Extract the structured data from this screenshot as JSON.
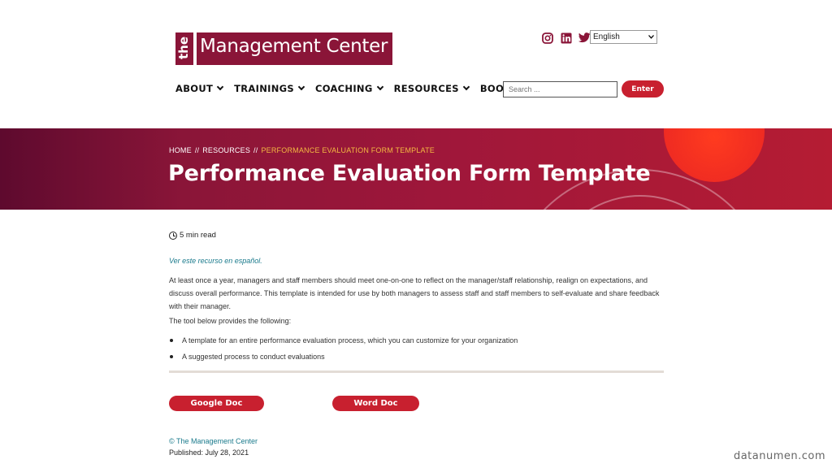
{
  "header": {
    "logo_the": "the",
    "logo_main": "Management Center",
    "social": [
      "instagram-icon",
      "linkedin-icon",
      "twitter-icon"
    ],
    "language": "English",
    "nav": [
      {
        "label": "ABOUT",
        "has_menu": true
      },
      {
        "label": "TRAININGS",
        "has_menu": true
      },
      {
        "label": "COACHING",
        "has_menu": true
      },
      {
        "label": "RESOURCES",
        "has_menu": true
      },
      {
        "label": "BOOK",
        "has_menu": false
      }
    ],
    "search_placeholder": "Search ...",
    "enter_label": "Enter"
  },
  "banner": {
    "breadcrumb": {
      "home": "HOME",
      "sep": "//",
      "resources": "RESOURCES",
      "current": "PERFORMANCE EVALUATION FORM TEMPLATE"
    },
    "title": "Performance Evaluation Form Template"
  },
  "content": {
    "read_time": "5 min read",
    "spanish_link": "Ver este recurso en español.",
    "intro": "At least once a year, managers and staff members should meet one-on-one to reflect on the manager/staff relationship, realign on expectations, and discuss overall performance. This template is intended for use by both managers to assess staff and staff members to self-evaluate and share feedback with their manager.",
    "tool_intro": "The tool below provides the following:",
    "bullets": [
      "A template for an entire performance evaluation process, which you can customize for your organization",
      "A suggested process to conduct evaluations"
    ],
    "google_doc": "Google Doc",
    "word_doc": "Word Doc",
    "copyright": "© The Management Center",
    "published": "Published: July 28, 2021"
  },
  "watermark": "datanumen.com",
  "colors": {
    "brand": "#8a1538",
    "accent": "#c8202f",
    "link": "#1a7a8c",
    "breadcrumb_current": "#f4b942"
  }
}
